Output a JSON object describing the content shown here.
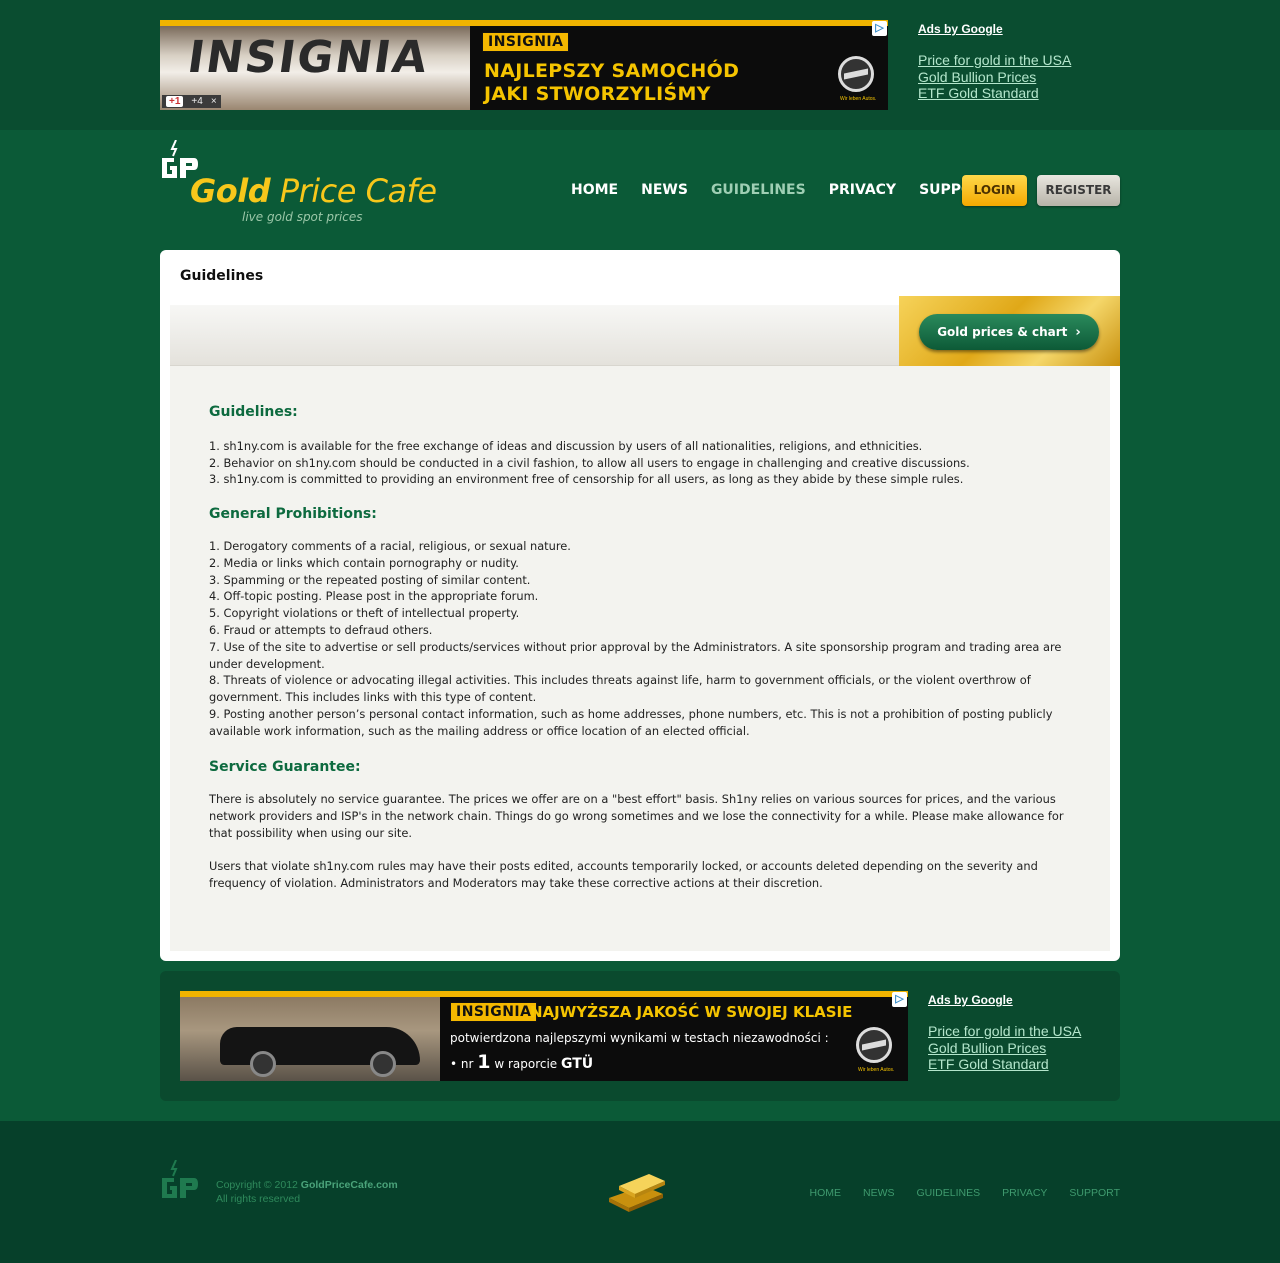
{
  "top_ad": {
    "brand_tag": "INSIGNIA",
    "image_text": "INSIGNIA",
    "headline_line1": "NAJLEPSZY SAMOCHÓD",
    "headline_line2": "JAKI STWORZYLIŚMY",
    "gplus_label": "+1",
    "gplus_count": "+4",
    "close_symbol": "×",
    "opel_tagline": "Wir leben Autos."
  },
  "top_ads_sidebar": {
    "title": "Ads by Google",
    "links": [
      "Price for gold in the USA",
      "Gold Bullion Prices",
      "ETF Gold Standard"
    ]
  },
  "logo": {
    "title_bold": "Gold",
    "title_rest": " Price Cafe",
    "tagline": "live gold spot prices"
  },
  "nav": {
    "items": [
      "HOME",
      "NEWS",
      "GUIDELINES",
      "PRIVACY",
      "SUPPORT"
    ],
    "active": "GUIDELINES",
    "login": "LOGIN",
    "register": "REGISTER"
  },
  "page": {
    "title": "Guidelines",
    "gold_button": "Gold prices & chart",
    "gold_button_chevron": "›"
  },
  "guidelines": {
    "heading": "Guidelines:",
    "items": [
      "1. sh1ny.com is available for the free exchange of ideas and discussion by users of all nationalities, religions, and ethnicities.",
      "2. Behavior on sh1ny.com should be conducted in a civil fashion, to allow all users to engage in challenging and creative discussions.",
      "3. sh1ny.com is committed to providing an environment free of censorship for all users, as long as they abide by these simple rules."
    ]
  },
  "prohibitions": {
    "heading": "General Prohibitions:",
    "items": [
      "1. Derogatory comments of a racial, religious, or sexual nature.",
      "2. Media or links which contain pornography or nudity.",
      "3. Spamming or the repeated posting of similar content.",
      "4. Off-topic posting. Please post in the appropriate forum.",
      "5. Copyright violations or theft of intellectual property.",
      "6. Fraud or attempts to defraud others.",
      "7. Use of the site to advertise or sell products/services without prior approval by the Administrators. A site sponsorship program and trading area are under development.",
      "8. Threats of violence or advocating illegal activities. This includes threats against life, harm to government officials, or the violent overthrow of government. This includes links with this type of content.",
      "9. Posting another person’s personal contact information, such as home addresses, phone numbers, etc. This is not a prohibition of posting publicly available work information, such as the mailing address or office location of an elected official."
    ]
  },
  "service": {
    "heading": "Service Guarantee:",
    "paragraph1": "There is absolutely no service guarantee. The prices we offer are on a \"best effort\" basis. Sh1ny relies on various sources for prices, and the various network providers and ISP's in the network chain. Things do go wrong sometimes and we lose the connectivity for a while. Please make allowance for that possibility when using our site.",
    "paragraph2": "Users that violate sh1ny.com rules may have their posts edited, accounts temporarily locked, or accounts deleted depending on the severity and frequency of violation. Administrators and Moderators may take these corrective actions at their discretion."
  },
  "bottom_ad": {
    "brand_tag": "INSIGNIA",
    "headline": "NAJWYŻSZA JAKOŚĆ W SWOJEJ KLASIE",
    "line2": "potwierdzona najlepszymi wynikami w testach niezawodności :",
    "line3_prefix": "• nr",
    "line3_number": "1",
    "line3_mid": " w raporcie ",
    "line3_brand": "GTÜ",
    "opel_tagline": "Wir leben Autos."
  },
  "bottom_ads_sidebar": {
    "title": "Ads by Google",
    "links": [
      "Price for gold in the USA",
      "Gold Bullion Prices",
      "ETF Gold Standard"
    ]
  },
  "footer": {
    "copyright_prefix": "Copyright © 2012 ",
    "copyright_site": "GoldPriceCafe.com",
    "rights": "All rights reserved",
    "nav": [
      "HOME",
      "NEWS",
      "GUIDELINES",
      "PRIVACY",
      "SUPPORT"
    ]
  },
  "colors": {
    "background": "#0b5a37",
    "accent_gold": "#f7c71b",
    "heading_green": "#0d6a3f",
    "active_nav": "#9fcfb4"
  }
}
